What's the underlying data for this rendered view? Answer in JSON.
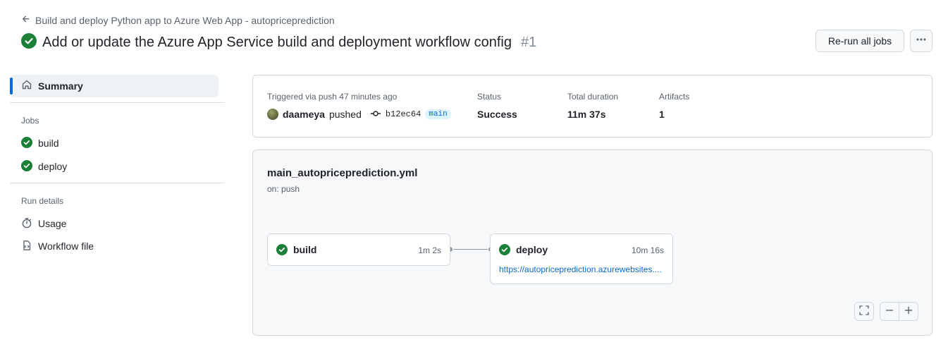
{
  "header": {
    "back_link": "Build and deploy Python app to Azure Web App - autopriceprediction",
    "title": "Add or update the Azure App Service build and deployment workflow config",
    "run_number": "#1",
    "rerun_label": "Re-run all jobs",
    "more_label": "···"
  },
  "sidebar": {
    "summary_label": "Summary",
    "jobs_heading": "Jobs",
    "jobs": [
      {
        "label": "build"
      },
      {
        "label": "deploy"
      }
    ],
    "run_details_heading": "Run details",
    "run_details": [
      {
        "label": "Usage",
        "icon": "stopwatch-icon"
      },
      {
        "label": "Workflow file",
        "icon": "file-code-icon"
      }
    ]
  },
  "summary": {
    "trigger_label": "Triggered via push 47 minutes ago",
    "actor": "daameya",
    "action": "pushed",
    "commit_sha": "b12ec64",
    "branch": "main",
    "status_label": "Status",
    "status_value": "Success",
    "duration_label": "Total duration",
    "duration_value": "11m 37s",
    "artifacts_label": "Artifacts",
    "artifacts_value": "1"
  },
  "graph": {
    "workflow_file": "main_autopriceprediction.yml",
    "trigger": "on: push",
    "jobs": [
      {
        "name": "build",
        "duration": "1m 2s"
      },
      {
        "name": "deploy",
        "duration": "10m 16s",
        "link": "https://autopriceprediction.azurewebsites...."
      }
    ]
  },
  "colors": {
    "success": "#1a7f37",
    "accent": "#0969da",
    "muted": "#59636e",
    "border": "#d1d9e0"
  }
}
